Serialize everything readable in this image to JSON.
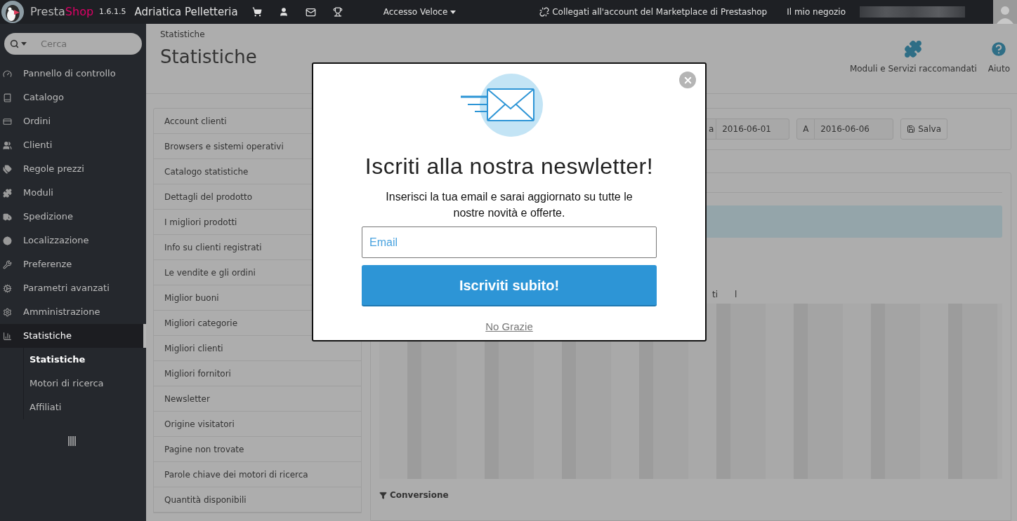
{
  "topbar": {
    "logo": {
      "part_1": "Presta",
      "part_2": "Shop"
    },
    "version": "1.6.1.5",
    "shop_name": "Adriatica Pelletteria",
    "quick_access": "Accesso Veloce",
    "marketplace_link": "Collegati all'account del Marketplace di Prestashop",
    "my_shop": "Il mio negozio"
  },
  "sidebar": {
    "search": {
      "placeholder": "Cerca"
    },
    "items": [
      {
        "label": "Pannello di controllo",
        "selected": false
      },
      {
        "label": "Catalogo",
        "selected": false
      },
      {
        "label": "Ordini",
        "selected": false
      },
      {
        "label": "Clienti",
        "selected": false
      },
      {
        "label": "Regole prezzi",
        "selected": false
      },
      {
        "label": "Moduli",
        "selected": false
      },
      {
        "label": "Spedizione",
        "selected": false
      },
      {
        "label": "Localizzazione",
        "selected": false
      },
      {
        "label": "Preferenze",
        "selected": false
      },
      {
        "label": "Parametri avanzati",
        "selected": false
      },
      {
        "label": "Amministrazione",
        "selected": false
      },
      {
        "label": "Statistiche",
        "selected": true,
        "children": [
          {
            "label": "Statistiche",
            "selected": true
          },
          {
            "label": "Motori di ricerca",
            "selected": false
          },
          {
            "label": "Affiliati",
            "selected": false
          }
        ]
      }
    ]
  },
  "header": {
    "breadcrumb": "Statistiche",
    "title": "Statistiche",
    "toolbar": [
      "Moduli e Servizi raccomandati",
      "Aiuto"
    ]
  },
  "stats_menu": [
    "Account clienti",
    "Browsers e sistemi operativi",
    "Catalogo statistiche",
    "Dettagli del prodotto",
    "I migliori prodotti",
    "Info su clienti registrati",
    "Le vendite e gli ordini",
    "Miglior buoni",
    "Migliori categorie",
    "Migliori clienti",
    "Migliori fornitori",
    "Newsletter",
    "Origine visitatori",
    "Pagine non trovate",
    "Parole chiave dei motori di ricerca",
    "Quantità disponibili"
  ],
  "date_filter": {
    "from_label": "a",
    "from": "2016-06-01",
    "to_label": "A",
    "to": "2016-06-06",
    "save": "Salva"
  },
  "tab_fragments": [
    "ti",
    "l"
  ],
  "section_heading": "Conversione",
  "modal": {
    "title": "Iscriti alla nostra neswletter!",
    "text": "Inserisci la tua email e sarai aggiornato su tutte le nostre novità e offerte.",
    "email": {
      "placeholder": "Email"
    },
    "submit": "Iscriviti subito!",
    "decline": "No Grazie"
  }
}
